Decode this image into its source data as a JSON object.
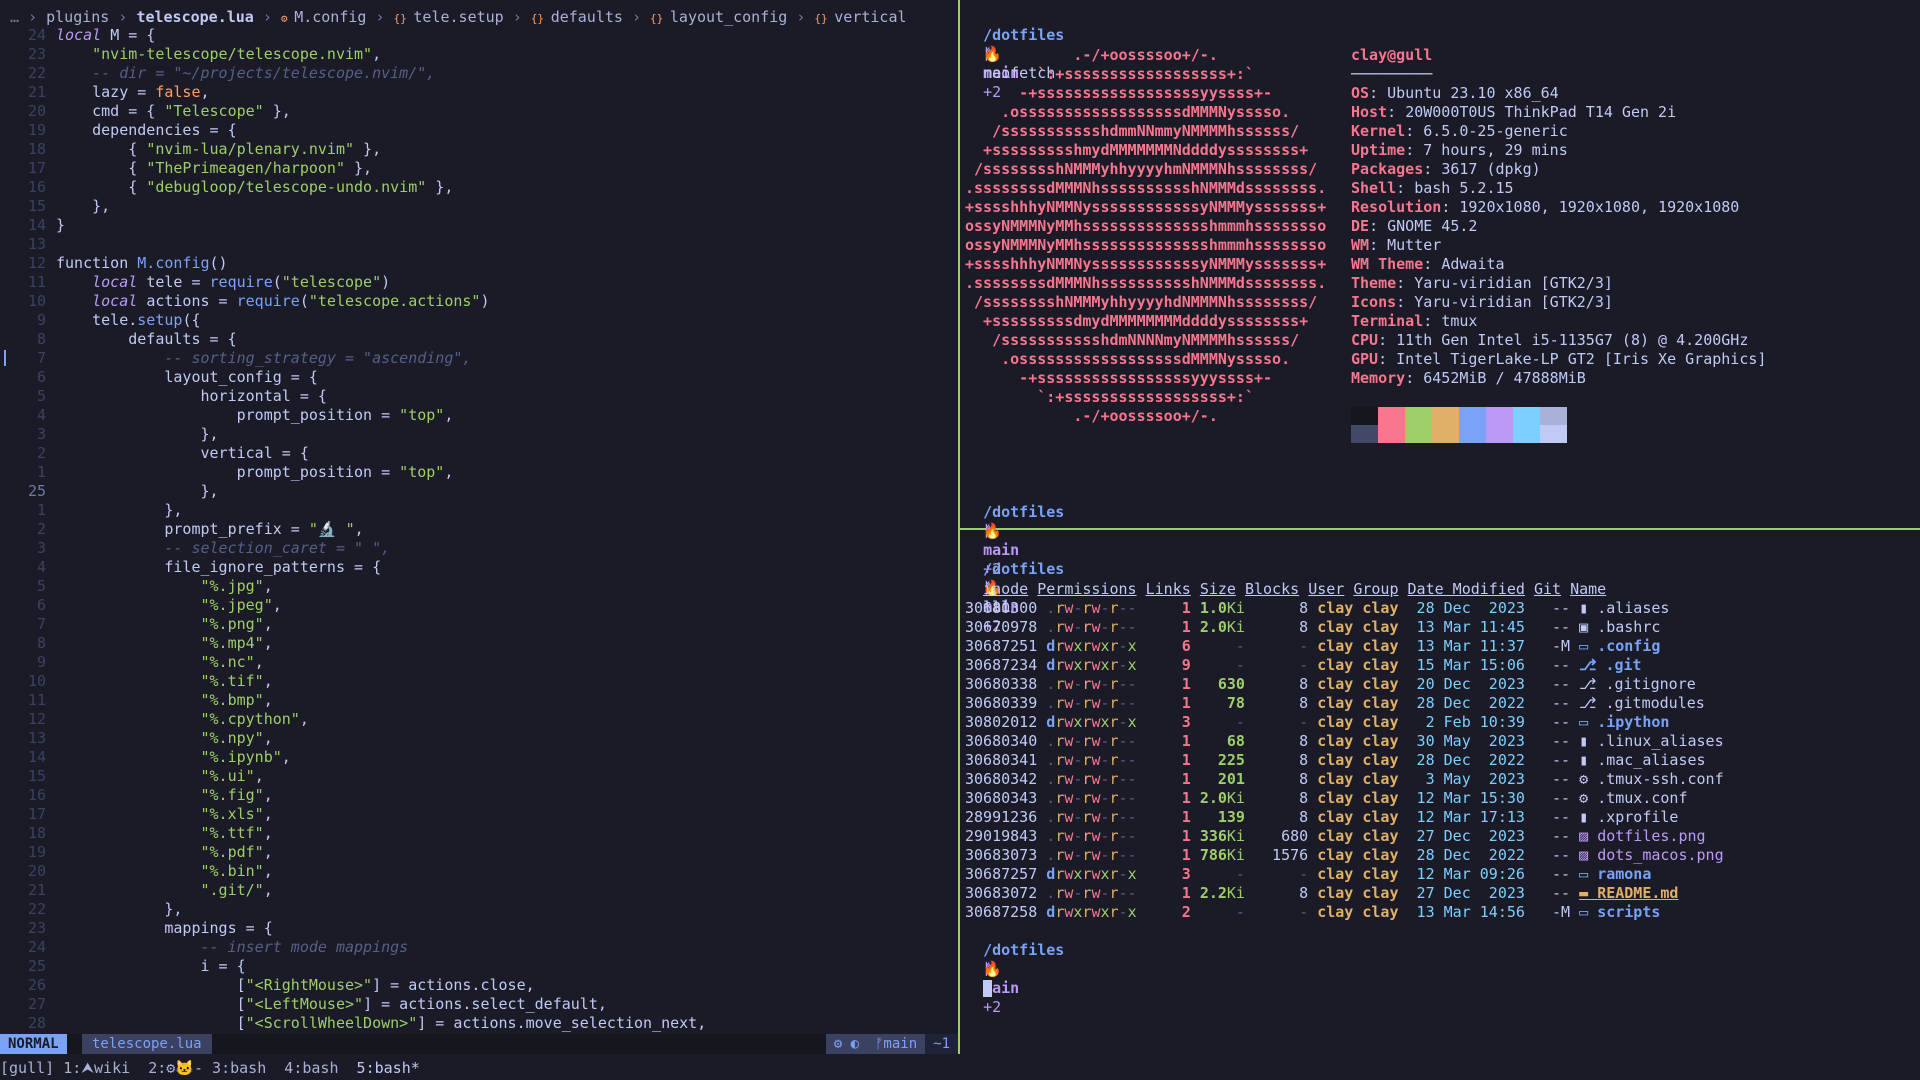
{
  "breadcrumb": {
    "ellipsis": "…",
    "items": [
      "plugins",
      "telescope.lua",
      "M.config",
      "tele.setup",
      "defaults",
      "layout_config",
      "vertical"
    ]
  },
  "code": [
    {
      "ln": "24",
      "t": [
        [
          "kw",
          "local "
        ],
        [
          "var",
          "M"
        ],
        [
          "tbl",
          " = {"
        ]
      ]
    },
    {
      "ln": "23",
      "t": [
        [
          "tbl",
          "    "
        ],
        [
          "str",
          "\"nvim-telescope/telescope.nvim\""
        ],
        [
          "tbl",
          ","
        ]
      ]
    },
    {
      "ln": "22",
      "t": [
        [
          "cmt",
          "    -- dir = \"~/projects/telescope.nvim/\","
        ]
      ]
    },
    {
      "ln": "21",
      "t": [
        [
          "tbl",
          "    lazy = "
        ],
        [
          "num",
          "false"
        ],
        [
          "tbl",
          ","
        ]
      ]
    },
    {
      "ln": "20",
      "t": [
        [
          "tbl",
          "    cmd = { "
        ],
        [
          "str",
          "\"Telescope\""
        ],
        [
          "tbl",
          " },"
        ]
      ]
    },
    {
      "ln": "19",
      "t": [
        [
          "tbl",
          "    dependencies = {"
        ]
      ]
    },
    {
      "ln": "18",
      "t": [
        [
          "tbl",
          "        { "
        ],
        [
          "str",
          "\"nvim-lua/plenary.nvim\""
        ],
        [
          "tbl",
          " },"
        ]
      ]
    },
    {
      "ln": "17",
      "t": [
        [
          "tbl",
          "        { "
        ],
        [
          "str",
          "\"ThePrimeagen/harpoon\""
        ],
        [
          "tbl",
          " },"
        ]
      ]
    },
    {
      "ln": "16",
      "t": [
        [
          "tbl",
          "        { "
        ],
        [
          "str",
          "\"debugloop/telescope-undo.nvim\""
        ],
        [
          "tbl",
          " },"
        ]
      ]
    },
    {
      "ln": "15",
      "t": [
        [
          "tbl",
          "    },"
        ]
      ]
    },
    {
      "ln": "14",
      "t": [
        [
          "tbl",
          "}"
        ]
      ]
    },
    {
      "ln": "13",
      "t": [
        [
          "tbl",
          ""
        ]
      ]
    },
    {
      "ln": "12",
      "t": [
        [
          "tbl",
          "function "
        ],
        [
          "fn",
          "M.config"
        ],
        [
          "tbl",
          "()"
        ]
      ]
    },
    {
      "ln": "11",
      "t": [
        [
          "kw",
          "    local "
        ],
        [
          "tbl",
          "tele = "
        ],
        [
          "fn",
          "require"
        ],
        [
          "tbl",
          "("
        ],
        [
          "str",
          "\"telescope\""
        ],
        [
          "tbl",
          ")"
        ]
      ]
    },
    {
      "ln": "10",
      "t": [
        [
          "kw",
          "    local "
        ],
        [
          "tbl",
          "actions = "
        ],
        [
          "fn",
          "require"
        ],
        [
          "tbl",
          "("
        ],
        [
          "str",
          "\"telescope.actions\""
        ],
        [
          "tbl",
          ")"
        ]
      ]
    },
    {
      "ln": "9",
      "t": [
        [
          "tbl",
          "    tele."
        ],
        [
          "fn",
          "setup"
        ],
        [
          "tbl",
          "({"
        ]
      ]
    },
    {
      "ln": "8",
      "t": [
        [
          "tbl",
          "        defaults = {"
        ]
      ]
    },
    {
      "ln": "7",
      "t": [
        [
          "cmt",
          "            -- sorting_strategy = \"ascending\","
        ]
      ]
    },
    {
      "ln": "6",
      "t": [
        [
          "tbl",
          "            layout_config = {"
        ]
      ]
    },
    {
      "ln": "5",
      "t": [
        [
          "tbl",
          "                horizontal = {"
        ]
      ]
    },
    {
      "ln": "4",
      "t": [
        [
          "tbl",
          "                    prompt_position = "
        ],
        [
          "str",
          "\"top\""
        ],
        [
          "tbl",
          ","
        ]
      ]
    },
    {
      "ln": "3",
      "t": [
        [
          "tbl",
          "                },"
        ]
      ]
    },
    {
      "ln": "2",
      "t": [
        [
          "tbl",
          "                vertical = {"
        ]
      ]
    },
    {
      "ln": "1",
      "t": [
        [
          "tbl",
          "                    prompt_position = "
        ],
        [
          "str",
          "\"top\""
        ],
        [
          "tbl",
          ","
        ]
      ]
    },
    {
      "ln": "25",
      "cur": true,
      "t": [
        [
          "tbl",
          "                },"
        ]
      ]
    },
    {
      "ln": "1",
      "t": [
        [
          "tbl",
          "            },"
        ]
      ]
    },
    {
      "ln": "2",
      "t": [
        [
          "tbl",
          "            prompt_prefix = "
        ],
        [
          "str",
          "\"🔬 \""
        ],
        [
          "tbl",
          ","
        ]
      ]
    },
    {
      "ln": "3",
      "t": [
        [
          "cmt",
          "            -- selection_caret = \" \","
        ]
      ]
    },
    {
      "ln": "4",
      "t": [
        [
          "tbl",
          "            file_ignore_patterns = {"
        ]
      ]
    },
    {
      "ln": "5",
      "t": [
        [
          "str",
          "                \"%.jpg\""
        ],
        [
          "tbl",
          ","
        ]
      ]
    },
    {
      "ln": "6",
      "t": [
        [
          "str",
          "                \"%.jpeg\""
        ],
        [
          "tbl",
          ","
        ]
      ]
    },
    {
      "ln": "7",
      "t": [
        [
          "str",
          "                \"%.png\""
        ],
        [
          "tbl",
          ","
        ]
      ]
    },
    {
      "ln": "8",
      "t": [
        [
          "str",
          "                \"%.mp4\""
        ],
        [
          "tbl",
          ","
        ]
      ]
    },
    {
      "ln": "9",
      "t": [
        [
          "str",
          "                \"%.nc\""
        ],
        [
          "tbl",
          ","
        ]
      ]
    },
    {
      "ln": "10",
      "t": [
        [
          "str",
          "                \"%.tif\""
        ],
        [
          "tbl",
          ","
        ]
      ]
    },
    {
      "ln": "11",
      "t": [
        [
          "str",
          "                \"%.bmp\""
        ],
        [
          "tbl",
          ","
        ]
      ]
    },
    {
      "ln": "12",
      "t": [
        [
          "str",
          "                \"%.cpython\""
        ],
        [
          "tbl",
          ","
        ]
      ]
    },
    {
      "ln": "13",
      "t": [
        [
          "str",
          "                \"%.npy\""
        ],
        [
          "tbl",
          ","
        ]
      ]
    },
    {
      "ln": "14",
      "t": [
        [
          "str",
          "                \"%.ipynb\""
        ],
        [
          "tbl",
          ","
        ]
      ]
    },
    {
      "ln": "15",
      "t": [
        [
          "str",
          "                \"%.ui\""
        ],
        [
          "tbl",
          ","
        ]
      ]
    },
    {
      "ln": "16",
      "t": [
        [
          "str",
          "                \"%.fig\""
        ],
        [
          "tbl",
          ","
        ]
      ]
    },
    {
      "ln": "17",
      "t": [
        [
          "str",
          "                \"%.xls\""
        ],
        [
          "tbl",
          ","
        ]
      ]
    },
    {
      "ln": "18",
      "t": [
        [
          "str",
          "                \"%.ttf\""
        ],
        [
          "tbl",
          ","
        ]
      ]
    },
    {
      "ln": "19",
      "t": [
        [
          "str",
          "                \"%.pdf\""
        ],
        [
          "tbl",
          ","
        ]
      ]
    },
    {
      "ln": "20",
      "t": [
        [
          "str",
          "                \"%.bin\""
        ],
        [
          "tbl",
          ","
        ]
      ]
    },
    {
      "ln": "21",
      "t": [
        [
          "str",
          "                \".git/\""
        ],
        [
          "tbl",
          ","
        ]
      ]
    },
    {
      "ln": "22",
      "t": [
        [
          "tbl",
          "            },"
        ]
      ]
    },
    {
      "ln": "23",
      "t": [
        [
          "tbl",
          "            mappings = {"
        ]
      ]
    },
    {
      "ln": "24",
      "t": [
        [
          "cmt",
          "                -- insert mode mappings"
        ]
      ]
    },
    {
      "ln": "25",
      "t": [
        [
          "tbl",
          "                i = {"
        ]
      ]
    },
    {
      "ln": "26",
      "t": [
        [
          "tbl",
          "                    ["
        ],
        [
          "str",
          "\"<RightMouse>\""
        ],
        [
          "tbl",
          "] = actions.close,"
        ]
      ]
    },
    {
      "ln": "27",
      "t": [
        [
          "tbl",
          "                    ["
        ],
        [
          "str",
          "\"<LeftMouse>\""
        ],
        [
          "tbl",
          "] = actions.select_default,"
        ]
      ]
    },
    {
      "ln": "28",
      "t": [
        [
          "tbl",
          "                    ["
        ],
        [
          "str",
          "\"<ScrollWheelDown>\""
        ],
        [
          "tbl",
          "] = actions.move_selection_next,"
        ]
      ]
    }
  ],
  "statusline": {
    "mode": "NORMAL",
    "filename": "telescope.lua",
    "branch": "main",
    "diff": "~1"
  },
  "shell": {
    "path": "/dotfiles",
    "branch": "main",
    "dirty": "+2"
  },
  "neofetch": {
    "command": "neofetch",
    "ascii": [
      "            .-/+oossssoo+/-.",
      "        `:+ssssssssssssssssss+:`",
      "      -+ssssssssssssssssssyyssss+-",
      "    .ossssssssssssssssssdMMMNysssso.",
      "   /ssssssssssshdmmNNmmyNMMMMhssssss/",
      "  +ssssssssshmydMMMMMMMNddddyssssssss+",
      " /sssssssshNMMMyhhyyyyhmNMMMNhssssssss/",
      ".ssssssssdMMMNhsssssssssshNMMMdssssssss.",
      "+sssshhhyNMMNyssssssssssssyNMMMysssssss+",
      "ossyNMMMNyMMhsssssssssssssshmmmhssssssso",
      "ossyNMMMNyMMhsssssssssssssshmmmhssssssso",
      "+sssshhhyNMMNyssssssssssssyNMMMysssssss+",
      ".ssssssssdMMMNhsssssssssshNMMMdssssssss.",
      " /sssssssshNMMMyhhyyyyhdNMMMNhssssssss/",
      "  +sssssssssdmydMMMMMMMMddddyssssssss+",
      "   /ssssssssssshdmNNNNmyNMMMMhssssss/",
      "    .ossssssssssssssssssdMMMNysssso.",
      "      -+sssssssssssssssssyyyssss+-",
      "        `:+ssssssssssssssssss+:`",
      "            .-/+oossssoo+/-."
    ],
    "user_host": "clay@gull",
    "underline": "─────────",
    "info": [
      {
        "k": "OS",
        "v": "Ubuntu 23.10 x86_64"
      },
      {
        "k": "Host",
        "v": "20W000T0US ThinkPad T14 Gen 2i"
      },
      {
        "k": "Kernel",
        "v": "6.5.0-25-generic"
      },
      {
        "k": "Uptime",
        "v": "7 hours, 29 mins"
      },
      {
        "k": "Packages",
        "v": "3617 (dpkg)"
      },
      {
        "k": "Shell",
        "v": "bash 5.2.15"
      },
      {
        "k": "Resolution",
        "v": "1920x1080, 1920x1080, 1920x1080"
      },
      {
        "k": "DE",
        "v": "GNOME 45.2"
      },
      {
        "k": "WM",
        "v": "Mutter"
      },
      {
        "k": "WM Theme",
        "v": "Adwaita"
      },
      {
        "k": "Theme",
        "v": "Yaru-viridian [GTK2/3]"
      },
      {
        "k": "Icons",
        "v": "Yaru-viridian [GTK2/3]"
      },
      {
        "k": "Terminal",
        "v": "tmux"
      },
      {
        "k": "CPU",
        "v": "11th Gen Intel i5-1135G7 (8) @ 4.200GHz"
      },
      {
        "k": "GPU",
        "v": "Intel TigerLake-LP GT2 [Iris Xe Graphics]"
      },
      {
        "k": "Memory",
        "v": "6452MiB / 47888MiB"
      }
    ],
    "palette_top": [
      "#15161e",
      "#f7768e",
      "#9ece6a",
      "#e0af68",
      "#7aa2f7",
      "#bb9af7",
      "#7dcfff",
      "#a9b1d6"
    ],
    "palette_bottom": [
      "#414868",
      "#f7768e",
      "#9ece6a",
      "#e0af68",
      "#7aa2f7",
      "#bb9af7",
      "#7dcfff",
      "#c0caf5"
    ]
  },
  "lll": {
    "command": "lll",
    "headers": [
      "inode",
      "Permissions",
      "Links",
      "Size",
      "Blocks",
      "User",
      "Group",
      "Date Modified",
      "Git",
      "Name"
    ],
    "rows": [
      {
        "inode": "30680300",
        "perm": ".rw-rw-r--",
        "links": "1",
        "size": "1.0",
        "unit": "Ki",
        "blocks": "8",
        "user": "clay",
        "group": "clay",
        "date": "28 Dec  2023",
        "git": "--",
        "icon": "file",
        "name": ".aliases",
        "type": "file"
      },
      {
        "inode": "30670978",
        "perm": ".rw-rw-r--",
        "links": "1",
        "size": "2.0",
        "unit": "Ki",
        "blocks": "8",
        "user": "clay",
        "group": "clay",
        "date": "13 Mar 11:45",
        "git": "--",
        "icon": "term",
        "name": ".bashrc",
        "type": "file"
      },
      {
        "inode": "30687251",
        "perm": "drwxrwxr-x",
        "links": "6",
        "size": "-",
        "unit": "",
        "blocks": "-",
        "user": "clay",
        "group": "clay",
        "date": "13 Mar 11:37",
        "git": "-M",
        "icon": "folder",
        "name": ".config",
        "type": "dir"
      },
      {
        "inode": "30687234",
        "perm": "drwxrwxr-x",
        "links": "9",
        "size": "-",
        "unit": "",
        "blocks": "-",
        "user": "clay",
        "group": "clay",
        "date": "15 Mar 15:06",
        "git": "--",
        "icon": "git",
        "name": ".git",
        "type": "dir"
      },
      {
        "inode": "30680338",
        "perm": ".rw-rw-r--",
        "links": "1",
        "size": "630",
        "unit": "",
        "blocks": "8",
        "user": "clay",
        "group": "clay",
        "date": "20 Dec  2023",
        "git": "--",
        "icon": "git",
        "name": ".gitignore",
        "type": "file"
      },
      {
        "inode": "30680339",
        "perm": ".rw-rw-r--",
        "links": "1",
        "size": "78",
        "unit": "",
        "blocks": "8",
        "user": "clay",
        "group": "clay",
        "date": "28 Dec  2022",
        "git": "--",
        "icon": "git",
        "name": ".gitmodules",
        "type": "file"
      },
      {
        "inode": "30802012",
        "perm": "drwxrwxr-x",
        "links": "3",
        "size": "-",
        "unit": "",
        "blocks": "-",
        "user": "clay",
        "group": "clay",
        "date": " 2 Feb 10:39",
        "git": "--",
        "icon": "folder",
        "name": ".ipython",
        "type": "dir"
      },
      {
        "inode": "30680340",
        "perm": ".rw-rw-r--",
        "links": "1",
        "size": "68",
        "unit": "",
        "blocks": "8",
        "user": "clay",
        "group": "clay",
        "date": "30 May  2023",
        "git": "--",
        "icon": "file",
        "name": ".linux_aliases",
        "type": "file"
      },
      {
        "inode": "30680341",
        "perm": ".rw-rw-r--",
        "links": "1",
        "size": "225",
        "unit": "",
        "blocks": "8",
        "user": "clay",
        "group": "clay",
        "date": "28 Dec  2022",
        "git": "--",
        "icon": "file",
        "name": ".mac_aliases",
        "type": "file"
      },
      {
        "inode": "30680342",
        "perm": ".rw-rw-r--",
        "links": "1",
        "size": "201",
        "unit": "",
        "blocks": "8",
        "user": "clay",
        "group": "clay",
        "date": " 3 May  2023",
        "git": "--",
        "icon": "gear",
        "name": ".tmux-ssh.conf",
        "type": "file"
      },
      {
        "inode": "30680343",
        "perm": ".rw-rw-r--",
        "links": "1",
        "size": "2.0",
        "unit": "Ki",
        "blocks": "8",
        "user": "clay",
        "group": "clay",
        "date": "12 Mar 15:30",
        "git": "--",
        "icon": "gear",
        "name": ".tmux.conf",
        "type": "file"
      },
      {
        "inode": "28991236",
        "perm": ".rw-rw-r--",
        "links": "1",
        "size": "139",
        "unit": "",
        "blocks": "8",
        "user": "clay",
        "group": "clay",
        "date": "12 Mar 17:13",
        "git": "--",
        "icon": "file",
        "name": ".xprofile",
        "type": "file"
      },
      {
        "inode": "29019843",
        "perm": ".rw-rw-r--",
        "links": "1",
        "size": "336",
        "unit": "Ki",
        "blocks": "680",
        "user": "clay",
        "group": "clay",
        "date": "27 Dec  2023",
        "git": "--",
        "icon": "image",
        "name": "dotfiles.png",
        "type": "img"
      },
      {
        "inode": "30683073",
        "perm": ".rw-rw-r--",
        "links": "1",
        "size": "786",
        "unit": "Ki",
        "blocks": "1576",
        "user": "clay",
        "group": "clay",
        "date": "28 Dec  2022",
        "git": "--",
        "icon": "image",
        "name": "dots_macos.png",
        "type": "img"
      },
      {
        "inode": "30687257",
        "perm": "drwxrwxr-x",
        "links": "3",
        "size": "-",
        "unit": "",
        "blocks": "-",
        "user": "clay",
        "group": "clay",
        "date": "12 Mar 09:26",
        "git": "--",
        "icon": "folder",
        "name": "ramona",
        "type": "dir"
      },
      {
        "inode": "30683072",
        "perm": ".rw-rw-r--",
        "links": "1",
        "size": "2.2",
        "unit": "Ki",
        "blocks": "8",
        "user": "clay",
        "group": "clay",
        "date": "27 Dec  2023",
        "git": "--",
        "icon": "readme",
        "name": "README.md",
        "type": "readme"
      },
      {
        "inode": "30687258",
        "perm": "drwxrwxr-x",
        "links": "2",
        "size": "-",
        "unit": "",
        "blocks": "-",
        "user": "clay",
        "group": "clay",
        "date": "13 Mar 14:56",
        "git": "-M",
        "icon": "folder",
        "name": "scripts",
        "type": "dir"
      }
    ]
  },
  "tmux": {
    "session": "[gull]",
    "windows": [
      "1:⮝wiki",
      "2:⚙🐱- 3:bash",
      "4:bash",
      "5:bash*"
    ]
  }
}
